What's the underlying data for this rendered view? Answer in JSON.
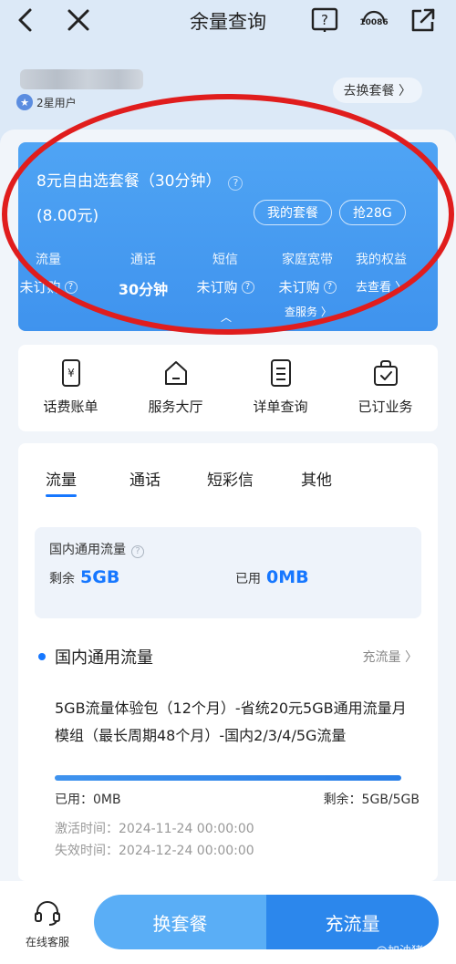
{
  "header": {
    "title": "余量查询",
    "help_label": "?",
    "hotline_label": "10086"
  },
  "user": {
    "level": "2星用户",
    "switch_plan": "去换套餐 〉"
  },
  "plan_card": {
    "name": "8元自由选套餐（30分钟）",
    "help": "?",
    "price": "(8.00元)",
    "my_plan_button": "我的套餐",
    "grab_button": "抢28G",
    "stats": [
      {
        "label": "流量",
        "value": "未订购"
      },
      {
        "label": "通话",
        "value": "30分钟"
      },
      {
        "label": "短信",
        "value": "未订购"
      },
      {
        "label": "家庭宽带",
        "value": "未订购"
      },
      {
        "label": "我的权益",
        "value": "去查看 〉"
      }
    ],
    "footer_link": "查服务 〉",
    "collapse_arrow": "︿"
  },
  "quick_actions": [
    {
      "label": "话费账单",
      "icon": "yen-phone-icon"
    },
    {
      "label": "服务大厅",
      "icon": "house-icon"
    },
    {
      "label": "详单查询",
      "icon": "list-doc-icon"
    },
    {
      "label": "已订业务",
      "icon": "bag-check-icon"
    }
  ],
  "usage": {
    "tabs": [
      "流量",
      "通话",
      "短彩信",
      "其他"
    ],
    "active_tab": "流量",
    "summary": {
      "title": "国内通用流量",
      "remaining_label": "剩余",
      "remaining_value": "5GB",
      "used_label": "已用",
      "used_value": "0MB"
    },
    "section": {
      "title": "国内通用流量",
      "link": "充流量 〉"
    },
    "package": {
      "description": "5GB流量体验包（12个月）-省统20元5GB通用流量月模组（最长周期48个月）-国内2/3/4/5G流量",
      "remaining_fraction": 1.0,
      "used": "已用：0MB",
      "remaining": "剩余：5GB/5GB",
      "activated": "激活时间：2024-11-24 00:00:00",
      "expires": "失效时间：2024-12-24 00:00:00"
    }
  },
  "bottom_bar": {
    "customer_service": "在线客服",
    "change_plan": "换套餐",
    "recharge_data": "充流量",
    "watermark": "@加油猪小悦"
  },
  "colors": {
    "accent": "#1677ff",
    "card_blue": "#4fa4f4",
    "annotation_red": "#e01d1d"
  }
}
